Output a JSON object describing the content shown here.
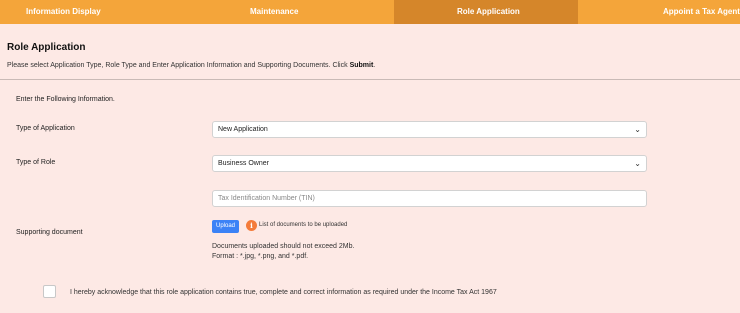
{
  "tabs": [
    {
      "label": "Information Display"
    },
    {
      "label": "Maintenance"
    },
    {
      "label": "Role Application"
    },
    {
      "label": "Appoint a Tax Agent"
    }
  ],
  "page": {
    "title": "Role Application",
    "instructions": "Please select Application Type, Role Type and Enter Application Information and Supporting Documents. Click ",
    "instructions_bold": "Submit",
    "instructions_end": "."
  },
  "form": {
    "section_label": "Enter the Following Information.",
    "type_of_application": {
      "label": "Type of Application",
      "value": "New Application"
    },
    "type_of_role": {
      "label": "Type of Role",
      "value": "Business Owner"
    },
    "tin": {
      "placeholder": "Tax Identification Number (TIN)"
    },
    "supporting_document": {
      "label": "Supporting document",
      "upload_label": "Upload",
      "info_icon_glyph": "i",
      "info_text": "List of documents to be uploaded",
      "note_size": "Documents uploaded should not exceed 2Mb.",
      "note_format": "Format : *.jpg, *.png, and *.pdf."
    },
    "acknowledgement": "I hereby acknowledge that this role application contains true, complete and correct information as required under the Income Tax Act 1967"
  },
  "colors": {
    "tab_bar": "#f4a53a",
    "tab_active": "#d5862a",
    "background": "#fde9e5",
    "upload_button": "#3b82f6",
    "info_icon": "#f47b3a"
  },
  "icons": {
    "select_chevron": "chevron-down-icon",
    "info": "info-icon"
  }
}
